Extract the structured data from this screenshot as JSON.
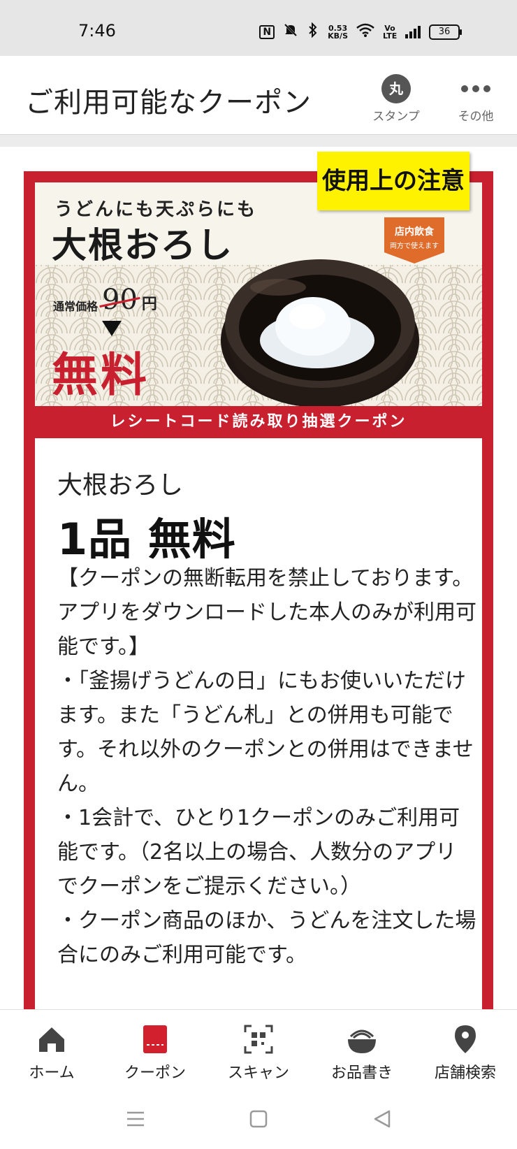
{
  "status_bar": {
    "time": "7:46",
    "net_speed_value": "0.53",
    "net_speed_unit": "KB/S",
    "volte": "Vo LTE",
    "battery": "36"
  },
  "header": {
    "title": "ご利用可能なクーポン",
    "stamp_label": "スタンプ",
    "stamp_icon_text": "丸",
    "more_label": "その他"
  },
  "coupon": {
    "notice_button": "使用上の注意",
    "banner": {
      "subtitle": "うどんにも天ぷらにも",
      "title": "大根おろし",
      "regular_price_label": "通常価格",
      "regular_price": "90",
      "price_unit": "円",
      "free_text": "無料",
      "badge_line1": "店内飲食",
      "badge_line2": "両方で使えます",
      "strip_text": "レシートコード読み取り抽選クーポン"
    },
    "item_name": "大根おろし",
    "offer": "1品 無料",
    "terms": "【クーポンの無断転用を禁止しております。アプリをダウンロードした本人のみが利用可能です。】\n・「釜揚げうどんの日」にもお使いいただけます。また「うどん札」との併用も可能です。それ以外のクーポンとの併用はできません。\n・1会計で、ひとり1クーポンのみご利用可能です。（2名以上の場合、人数分のアプリでクーポンをご提示ください。）\n・クーポン商品のほか、うどんを注文した場合にのみご利用可能です。"
  },
  "bottom_nav": {
    "items": [
      {
        "label": "ホーム",
        "icon": "home-icon"
      },
      {
        "label": "クーポン",
        "icon": "coupon-icon"
      },
      {
        "label": "スキャン",
        "icon": "qr-scan-icon"
      },
      {
        "label": "お品書き",
        "icon": "menu-bowl-icon"
      },
      {
        "label": "店舗検索",
        "icon": "location-pin-icon"
      }
    ],
    "active_index": 1
  },
  "colors": {
    "accent_red": "#c8202e",
    "notice_yellow": "#fff200",
    "status_bar_bg": "#e6e6e6"
  }
}
